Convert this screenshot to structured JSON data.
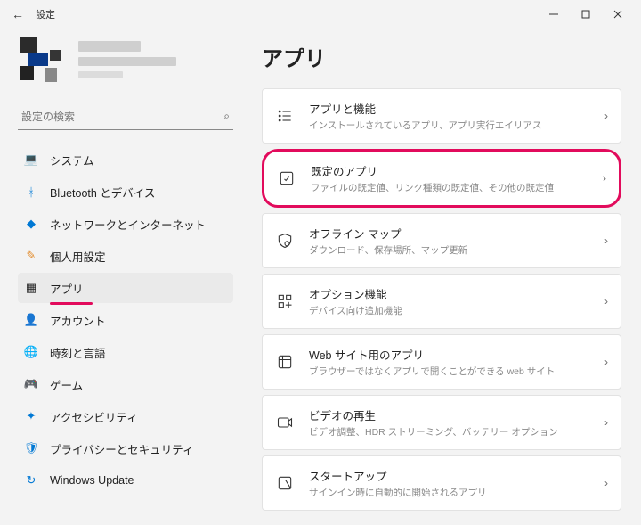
{
  "titlebar": {
    "title": "設定"
  },
  "search": {
    "placeholder": "設定の検索"
  },
  "nav": {
    "items": [
      {
        "label": "システム",
        "icon": "💻",
        "color": "ic-blue"
      },
      {
        "label": "Bluetooth とデバイス",
        "icon": "ᚼ",
        "color": "ic-blue"
      },
      {
        "label": "ネットワークとインターネット",
        "icon": "◆",
        "color": "ic-blue"
      },
      {
        "label": "個人用設定",
        "icon": "✎",
        "color": "ic-orange"
      },
      {
        "label": "アプリ",
        "icon": "▦",
        "color": ""
      },
      {
        "label": "アカウント",
        "icon": "👤",
        "color": "ic-green"
      },
      {
        "label": "時刻と言語",
        "icon": "🌐",
        "color": "ic-blue"
      },
      {
        "label": "ゲーム",
        "icon": "🎮",
        "color": ""
      },
      {
        "label": "アクセシビリティ",
        "icon": "✦",
        "color": "ic-blue"
      },
      {
        "label": "プライバシーとセキュリティ",
        "icon": "🛡",
        "color": "ic-blue"
      },
      {
        "label": "Windows Update",
        "icon": "↻",
        "color": "ic-blue"
      }
    ],
    "selected": 4
  },
  "page": {
    "title": "アプリ"
  },
  "cards": [
    {
      "title": "アプリと機能",
      "sub": "インストールされているアプリ、アプリ実行エイリアス",
      "hl": false
    },
    {
      "title": "既定のアプリ",
      "sub": "ファイルの既定値、リンク種類の既定値、その他の既定値",
      "hl": true
    },
    {
      "title": "オフライン マップ",
      "sub": "ダウンロード、保存場所、マップ更新",
      "hl": false
    },
    {
      "title": "オプション機能",
      "sub": "デバイス向け追加機能",
      "hl": false
    },
    {
      "title": "Web サイト用のアプリ",
      "sub": "ブラウザーではなくアプリで開くことができる web サイト",
      "hl": false
    },
    {
      "title": "ビデオの再生",
      "sub": "ビデオ調整、HDR ストリーミング、バッテリー オプション",
      "hl": false
    },
    {
      "title": "スタートアップ",
      "sub": "サインイン時に自動的に開始されるアプリ",
      "hl": false
    }
  ]
}
